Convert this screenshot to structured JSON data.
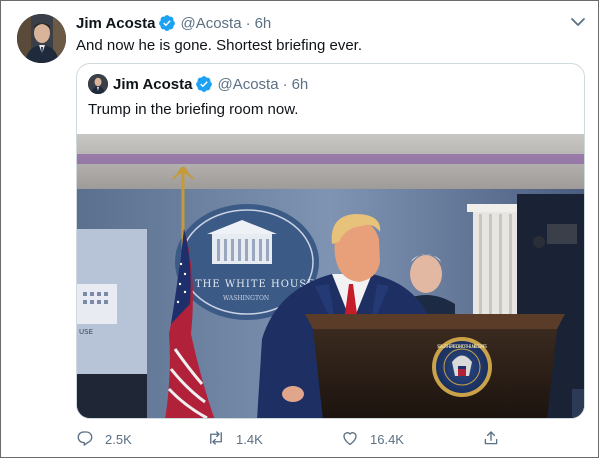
{
  "tweet": {
    "author_name": "Jim Acosta",
    "handle": "@Acosta",
    "separator": "·",
    "time": "6h",
    "text": "And now he is gone. Shortest briefing ever.",
    "avatar_icon": "user-avatar",
    "verified_icon": "verified-badge-icon",
    "more_icon": "chevron-down-icon"
  },
  "quoted": {
    "author_name": "Jim Acosta",
    "handle": "@Acosta",
    "separator": "·",
    "time": "6h",
    "text": "Trump in the briefing room now.",
    "seal_text": "SEAL OF THE PRESIDENT OF THE UNITED STATES",
    "backdrop_text": "THE WHITE HOUSE",
    "backdrop_subtext": "WASHINGTON",
    "monitor_text": "USE"
  },
  "actions": {
    "reply_count": "2.5K",
    "retweet_count": "1.4K",
    "like_count": "16.4K",
    "reply_icon": "reply-icon",
    "retweet_icon": "retweet-icon",
    "like_icon": "heart-icon",
    "share_icon": "share-icon"
  },
  "colors": {
    "verified_blue": "#1da1f2",
    "secondary_text": "#5b7083",
    "quote_border": "#cfd9de",
    "backdrop_blue": "#3b5a86"
  }
}
